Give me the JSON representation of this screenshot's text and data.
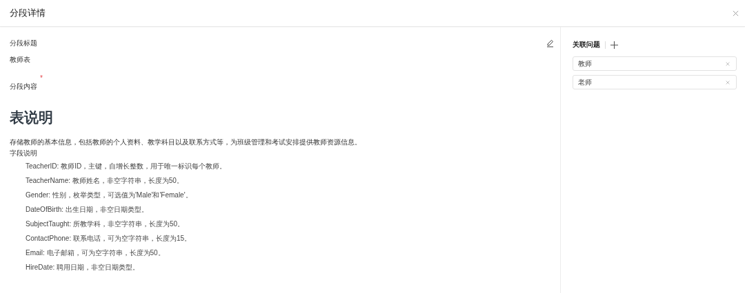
{
  "window": {
    "title": "分段详情"
  },
  "section_title": {
    "label": "分段标题",
    "value": "教师表"
  },
  "section_content": {
    "label": "分段内容",
    "required_mark": "*",
    "heading": "表说明",
    "paragraphs": [
      "存储教师的基本信息，包括教师的个人资料、教学科目以及联系方式等，为班级管理和考试安排提供教师资源信息。",
      "字段说明"
    ],
    "items": [
      "TeacherID: 教师ID，主键，自增长整数，用于唯一标识每个教师。",
      "TeacherName: 教师姓名，非空字符串，长度为50。",
      "Gender: 性别，枚举类型，可选值为'Male'和'Female'。",
      "DateOfBirth: 出生日期，非空日期类型。",
      "SubjectTaught: 所教学科，非空字符串，长度为50。",
      "ContactPhone: 联系电话，可为空字符串，长度为15。",
      "Email: 电子邮箱，可为空字符串，长度为50。",
      "HireDate: 聘用日期，非空日期类型。"
    ]
  },
  "related_questions": {
    "title": "关联问题",
    "tags": [
      "教师",
      "老师"
    ]
  }
}
